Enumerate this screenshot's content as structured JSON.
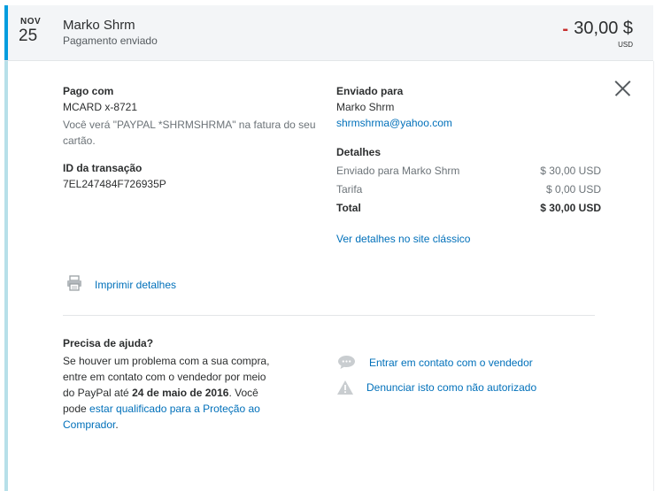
{
  "transaction": {
    "month": "NOV",
    "day": "25",
    "merchant": "Marko Shrm",
    "status": "Pagamento enviado",
    "amount_sign": "-",
    "amount": "30,00 $",
    "currency": "USD"
  },
  "paid_with": {
    "label": "Pago com",
    "card": "MCARD x-8721",
    "note": "Você verá \"PAYPAL *SHRMSHRMA\" na fatura do seu cartão."
  },
  "transaction_id": {
    "label": "ID da transação",
    "value": "7EL247484F726935P"
  },
  "sent_to": {
    "label": "Enviado para",
    "name": "Marko Shrm",
    "email": "shrmshrma@yahoo.com"
  },
  "details": {
    "label": "Detalhes",
    "rows": [
      {
        "label": "Enviado para Marko Shrm",
        "value": "$ 30,00 USD"
      },
      {
        "label": "Tarifa",
        "value": "$ 0,00 USD"
      },
      {
        "label": "Total",
        "value": "$ 30,00 USD"
      }
    ],
    "classic_link": "Ver detalhes no site clássico"
  },
  "print_link": "Imprimir detalhes",
  "help": {
    "title": "Precisa de ajuda?",
    "text_1": "Se houver um problema com a sua compra, entre em contato com o vendedor por meio do PayPal até ",
    "deadline": "24 de maio de 2016",
    "text_2": ". Você pode ",
    "protection_link": "estar qualificado para a Proteção ao Comprador",
    "text_3": ".",
    "contact_link": "Entrar em contato com o vendedor",
    "report_link": "Denunciar isto como não autorizado"
  },
  "icons": {
    "close": "close-icon",
    "print": "printer-icon",
    "chat": "chat-bubble-icon",
    "warning": "warning-triangle-icon"
  },
  "colors": {
    "accent": "#009cde",
    "link": "#0070ba",
    "negative": "#c72e2e",
    "side_bar": "#b7e0e9"
  }
}
